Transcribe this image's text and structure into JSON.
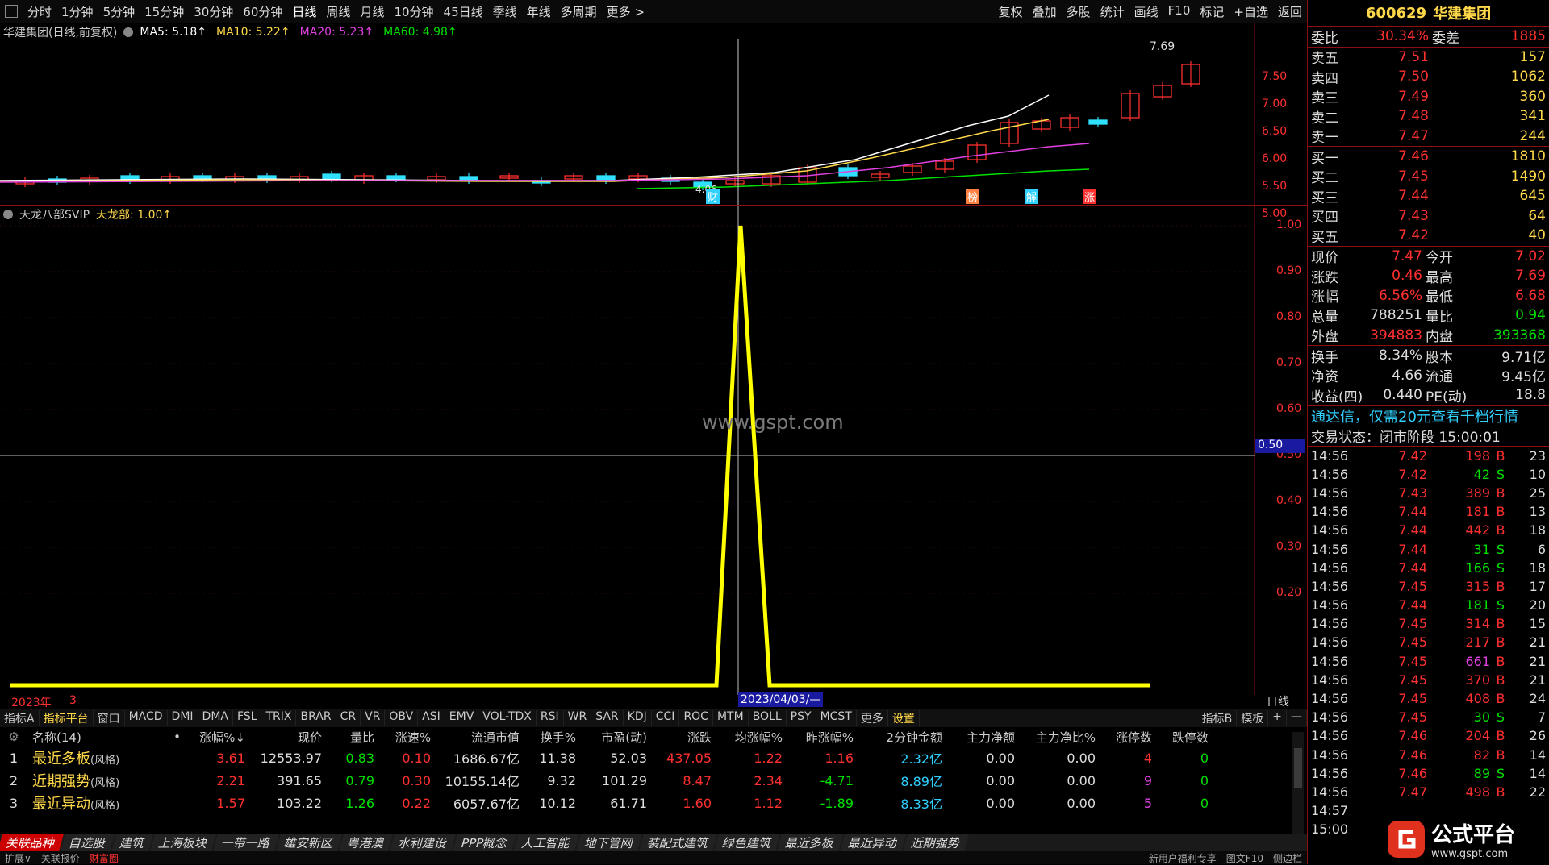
{
  "toolbar": {
    "periods": [
      "分时",
      "1分钟",
      "5分钟",
      "15分钟",
      "30分钟",
      "60分钟",
      "日线",
      "周线",
      "月线",
      "10分钟",
      "45日线",
      "季线",
      "年线",
      "多周期",
      "更多 >"
    ],
    "active_period": "日线",
    "right_items": [
      "复权",
      "叠加",
      "多股",
      "统计",
      "画线",
      "F10",
      "标记",
      "+自选",
      "返回"
    ]
  },
  "main_chart": {
    "title": "华建集团(日线,前复权)",
    "ma": [
      {
        "label": "MA5: 5.18↑",
        "color": "#ffffff"
      },
      {
        "label": "MA10: 5.22↑",
        "color": "#ffd84a"
      },
      {
        "label": "MA20: 5.23↑",
        "color": "#e040e0"
      },
      {
        "label": "MA60: 4.98↑",
        "color": "#00e000"
      }
    ],
    "price_axis": [
      "7.50",
      "7.00",
      "6.50",
      "6.00",
      "5.50",
      "5.00"
    ],
    "high_label": "7.69",
    "low_label": "4.06",
    "event_labels": [
      "财",
      "榜",
      "解",
      "涨"
    ]
  },
  "indicator": {
    "title": "天龙八部SVIP",
    "value_label": "天龙部: 1.00↑",
    "axis": [
      "1.00",
      "0.90",
      "0.80",
      "0.70",
      "0.60",
      "0.50",
      "0.40",
      "0.30",
      "0.20"
    ],
    "cursor_value": "0.50",
    "watermark": "www.gspt.com",
    "year_label": "2023年",
    "month_label": "3",
    "cursor_date": "2023/04/03/—",
    "period_label": "日线"
  },
  "chart_data": {
    "type": "line",
    "series": [
      {
        "name": "天龙部",
        "values": [
          0,
          0,
          0,
          0,
          0,
          0,
          0,
          0,
          0,
          0,
          0,
          0,
          0,
          0,
          0,
          0,
          0,
          0,
          0,
          0,
          0,
          0,
          0,
          0,
          1,
          0,
          0,
          0,
          0,
          0,
          0,
          0,
          0,
          0,
          0,
          0,
          0,
          0,
          0,
          0
        ]
      }
    ],
    "ylim": [
      0,
      1.05
    ]
  },
  "indicator_tabs": [
    "指标A",
    "指标平台",
    "窗口",
    "MACD",
    "DMI",
    "DMA",
    "FSL",
    "TRIX",
    "BRAR",
    "CR",
    "VR",
    "OBV",
    "ASI",
    "EMV",
    "VOL-TDX",
    "RSI",
    "WR",
    "SAR",
    "KDJ",
    "CCI",
    "ROC",
    "MTM",
    "BOLL",
    "PSY",
    "MCST",
    "更多",
    "设置"
  ],
  "indicator_tabs_right": [
    "指标B",
    "模板",
    "+",
    "—"
  ],
  "table": {
    "headers": [
      "名称(14)",
      "•",
      "涨幅%↓",
      "现价",
      "量比",
      "涨速%",
      "流通市值",
      "换手%",
      "市盈(动)",
      "涨跌",
      "均涨幅%",
      "昨涨幅%",
      "2分钟金额",
      "主力净额",
      "主力净比%",
      "涨停数",
      "跌停数"
    ],
    "rows": [
      {
        "idx": "1",
        "name": "最近多板",
        "tag": "(风格)",
        "cells": [
          "3.61",
          "12553.97",
          "0.83",
          "0.10",
          "1686.67亿",
          "11.38",
          "52.03",
          "437.05",
          "1.22",
          "1.16",
          "2.32亿",
          "0.00",
          "0.00",
          "4",
          "0"
        ]
      },
      {
        "idx": "2",
        "name": "近期强势",
        "tag": "(风格)",
        "cells": [
          "2.21",
          "391.65",
          "0.79",
          "0.30",
          "10155.14亿",
          "9.32",
          "101.29",
          "8.47",
          "2.34",
          "-4.71",
          "8.89亿",
          "0.00",
          "0.00",
          "9",
          "0"
        ]
      },
      {
        "idx": "3",
        "name": "最近异动",
        "tag": "(风格)",
        "cells": [
          "1.57",
          "103.22",
          "1.26",
          "0.22",
          "6057.67亿",
          "10.12",
          "61.71",
          "1.60",
          "1.12",
          "-1.89",
          "8.33亿",
          "0.00",
          "0.00",
          "5",
          "0"
        ]
      }
    ]
  },
  "categories": [
    "关联品种",
    "自选股",
    "建筑",
    "上海板块",
    "一带一路",
    "雄安新区",
    "粤港澳",
    "水利建设",
    "PPP概念",
    "人工智能",
    "地下管网",
    "装配式建筑",
    "绿色建筑",
    "最近多板",
    "最近异动",
    "近期强势"
  ],
  "status": [
    "扩展∨",
    "关联报价",
    "财富圈",
    "新用户福利专享",
    "图文F10",
    "侧边栏"
  ],
  "right_panel": {
    "code": "600629",
    "name": "华建集团",
    "ratio": {
      "l1": "委比",
      "v1": "30.34%",
      "l2": "委差",
      "v2": "1885"
    },
    "asks": [
      {
        "label": "卖五",
        "price": "7.51",
        "vol": "157"
      },
      {
        "label": "卖四",
        "price": "7.50",
        "vol": "1062"
      },
      {
        "label": "卖三",
        "price": "7.49",
        "vol": "360"
      },
      {
        "label": "卖二",
        "price": "7.48",
        "vol": "341"
      },
      {
        "label": "卖一",
        "price": "7.47",
        "vol": "244"
      }
    ],
    "bids": [
      {
        "label": "买一",
        "price": "7.46",
        "vol": "1810"
      },
      {
        "label": "买二",
        "price": "7.45",
        "vol": "1490"
      },
      {
        "label": "买三",
        "price": "7.44",
        "vol": "645"
      },
      {
        "label": "买四",
        "price": "7.43",
        "vol": "64"
      },
      {
        "label": "买五",
        "price": "7.42",
        "vol": "40"
      }
    ],
    "stats1": [
      {
        "a": "现价",
        "b": "7.47",
        "bc": "red",
        "c": "今开",
        "d": "7.02",
        "dc": "red"
      },
      {
        "a": "涨跌",
        "b": "0.46",
        "bc": "red",
        "c": "最高",
        "d": "7.69",
        "dc": "red"
      },
      {
        "a": "涨幅",
        "b": "6.56%",
        "bc": "red",
        "c": "最低",
        "d": "6.68",
        "dc": "red"
      },
      {
        "a": "总量",
        "b": "788251",
        "bc": "white",
        "c": "量比",
        "d": "0.94",
        "dc": "green"
      },
      {
        "a": "外盘",
        "b": "394883",
        "bc": "red",
        "c": "内盘",
        "d": "393368",
        "dc": "green"
      }
    ],
    "stats2": [
      {
        "a": "换手",
        "b": "8.34%",
        "c": "股本",
        "d": "9.71亿"
      },
      {
        "a": "净资",
        "b": "4.66",
        "c": "流通",
        "d": "9.45亿"
      },
      {
        "a": "收益(四)",
        "b": "0.440",
        "c": "PE(动)",
        "d": "18.8"
      }
    ],
    "promo": "通达信，仅需20元查看千档行情",
    "trade_state": "交易状态：闭市阶段 15:00:01",
    "ticks": [
      {
        "t": "14:56",
        "p": "7.42",
        "v": "198",
        "s": "B",
        "n": "23"
      },
      {
        "t": "14:56",
        "p": "7.42",
        "v": "42",
        "s": "S",
        "n": "10"
      },
      {
        "t": "14:56",
        "p": "7.43",
        "v": "389",
        "s": "B",
        "n": "25"
      },
      {
        "t": "14:56",
        "p": "7.44",
        "v": "181",
        "s": "B",
        "n": "13"
      },
      {
        "t": "14:56",
        "p": "7.44",
        "v": "442",
        "s": "B",
        "n": "18"
      },
      {
        "t": "14:56",
        "p": "7.44",
        "v": "31",
        "s": "S",
        "n": "6"
      },
      {
        "t": "14:56",
        "p": "7.44",
        "v": "166",
        "s": "S",
        "n": "18"
      },
      {
        "t": "14:56",
        "p": "7.45",
        "v": "315",
        "s": "B",
        "n": "17"
      },
      {
        "t": "14:56",
        "p": "7.44",
        "v": "181",
        "s": "S",
        "n": "20"
      },
      {
        "t": "14:56",
        "p": "7.45",
        "v": "314",
        "s": "B",
        "n": "15"
      },
      {
        "t": "14:56",
        "p": "7.45",
        "v": "217",
        "s": "B",
        "n": "21"
      },
      {
        "t": "14:56",
        "p": "7.45",
        "v": "661",
        "s": "B",
        "n": "21"
      },
      {
        "t": "14:56",
        "p": "7.45",
        "v": "370",
        "s": "B",
        "n": "21"
      },
      {
        "t": "14:56",
        "p": "7.45",
        "v": "408",
        "s": "B",
        "n": "24"
      },
      {
        "t": "14:56",
        "p": "7.45",
        "v": "30",
        "s": "S",
        "n": "7"
      },
      {
        "t": "14:56",
        "p": "7.46",
        "v": "204",
        "s": "B",
        "n": "26"
      },
      {
        "t": "14:56",
        "p": "7.46",
        "v": "82",
        "s": "B",
        "n": "14"
      },
      {
        "t": "14:56",
        "p": "7.46",
        "v": "89",
        "s": "S",
        "n": "14"
      },
      {
        "t": "14:56",
        "p": "7.47",
        "v": "498",
        "s": "B",
        "n": "22"
      },
      {
        "t": "14:57",
        "p": "",
        "v": "",
        "s": "",
        "n": ""
      },
      {
        "t": "15:00",
        "p": "",
        "v": "",
        "s": "",
        "n": ""
      }
    ],
    "logo_text": "公式平台",
    "logo_url": "www.gspt.com"
  }
}
